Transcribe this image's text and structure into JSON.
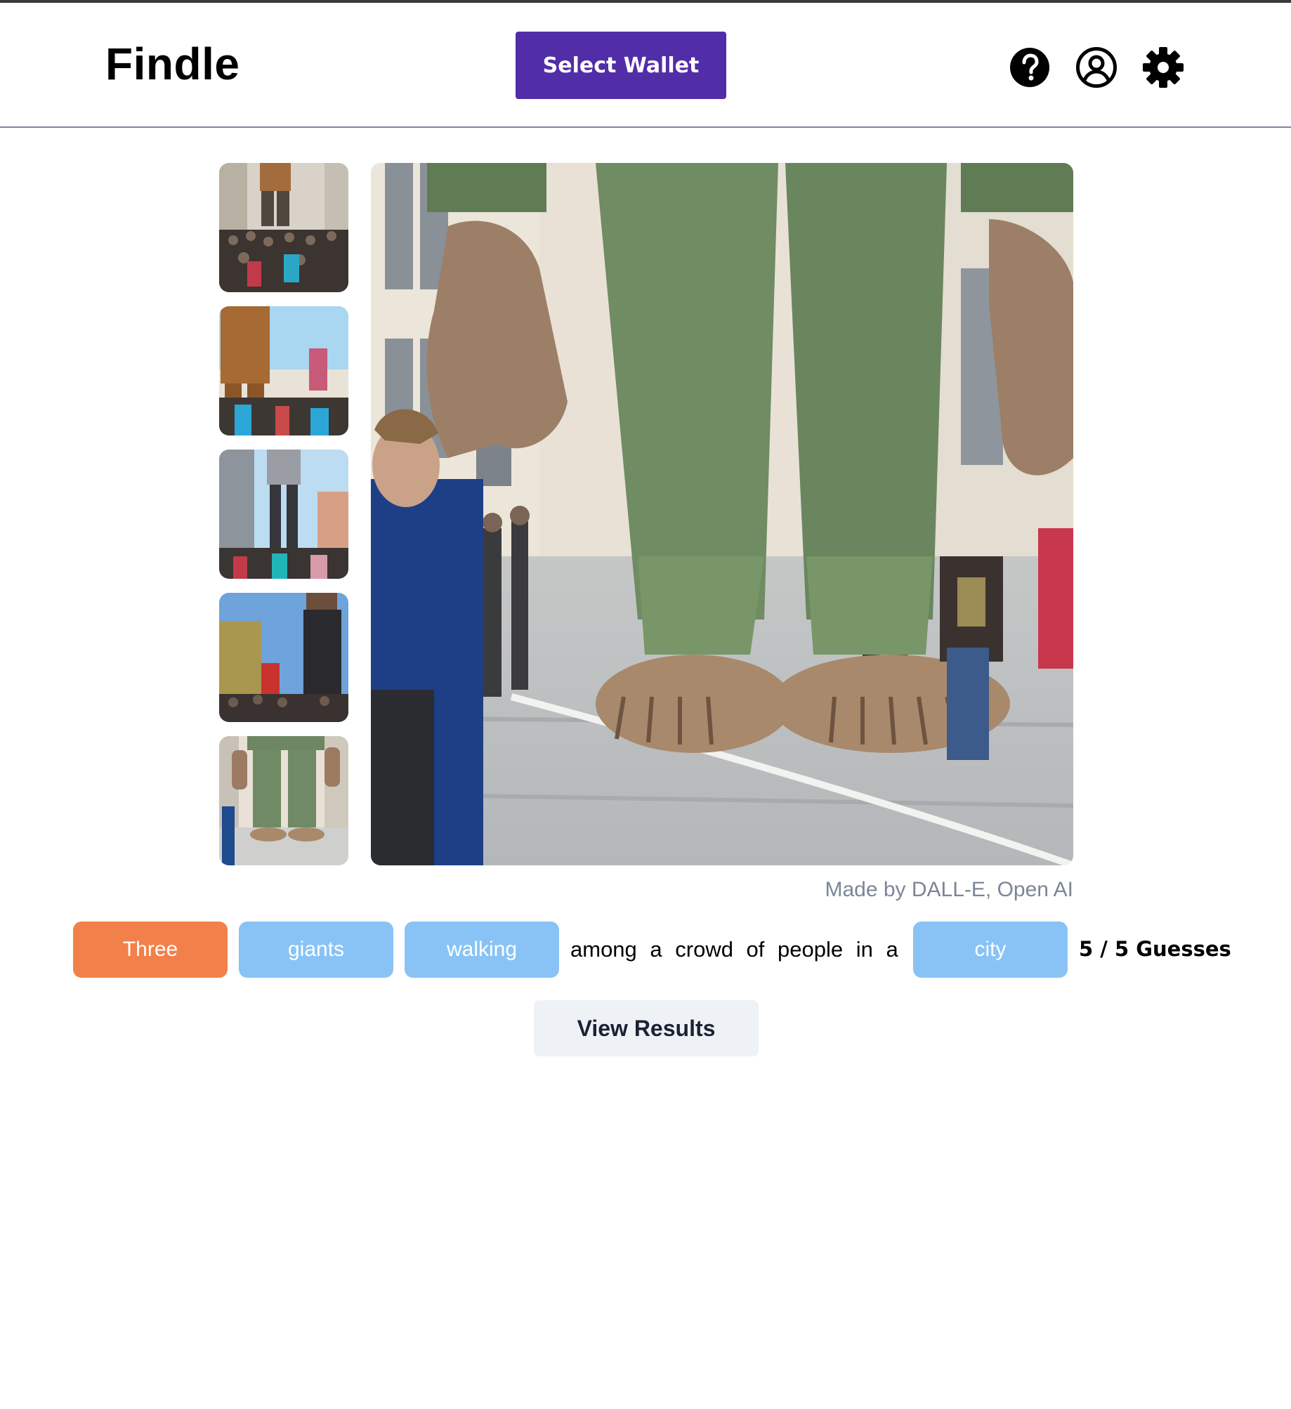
{
  "header": {
    "logo": "Findle",
    "wallet_button": "Select Wallet",
    "icons": [
      "question-circle-icon",
      "user-circle-icon",
      "gear-icon"
    ]
  },
  "gallery": {
    "thumbnails": [
      {
        "name": "thumbnail-1"
      },
      {
        "name": "thumbnail-2"
      },
      {
        "name": "thumbnail-3"
      },
      {
        "name": "thumbnail-4"
      },
      {
        "name": "thumbnail-5"
      }
    ],
    "credit": "Made by DALL-E, Open AI"
  },
  "guess": {
    "words": [
      {
        "text": "Three",
        "state": "correct"
      },
      {
        "text": "giants",
        "state": "hidden"
      },
      {
        "text": "walking",
        "state": "hidden"
      },
      {
        "text": "among a crowd of people in a",
        "state": "plain"
      },
      {
        "text": "city",
        "state": "hidden"
      }
    ],
    "counter": "5 / 5 Guesses"
  },
  "actions": {
    "view_results": "View Results"
  },
  "colors": {
    "brand_button": "#512da8",
    "chip_correct": "#f2804a",
    "chip_hidden": "#89c3f5",
    "credit_text": "#7a8698",
    "secondary_button": "#eef2f6"
  }
}
